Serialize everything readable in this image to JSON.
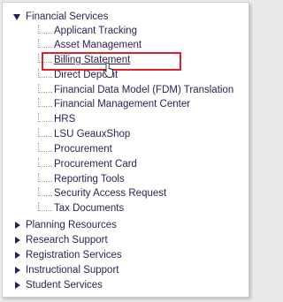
{
  "tree": {
    "expanded": {
      "label": "Financial Services",
      "children": [
        {
          "label": "Applicant Tracking"
        },
        {
          "label": "Asset Management"
        },
        {
          "label": "Billing Statement",
          "highlighted": true
        },
        {
          "label": "Direct Deposit"
        },
        {
          "label": "Financial Data Model (FDM) Translation"
        },
        {
          "label": "Financial Management Center"
        },
        {
          "label": "HRS"
        },
        {
          "label": "LSU GeauxShop"
        },
        {
          "label": "Procurement"
        },
        {
          "label": "Procurement Card"
        },
        {
          "label": "Reporting Tools"
        },
        {
          "label": "Security Access Request"
        },
        {
          "label": "Tax Documents"
        }
      ]
    },
    "collapsed": [
      {
        "label": "Planning Resources"
      },
      {
        "label": "Research Support"
      },
      {
        "label": "Registration Services"
      },
      {
        "label": "Instructional Support"
      },
      {
        "label": "Student Services"
      }
    ]
  },
  "colors": {
    "text": "#2a1f52",
    "highlight": "#e0202a"
  },
  "icons": {
    "expanded": "triangle-down-icon",
    "collapsed": "triangle-right-icon",
    "pointer": "hand-pointer-icon"
  }
}
